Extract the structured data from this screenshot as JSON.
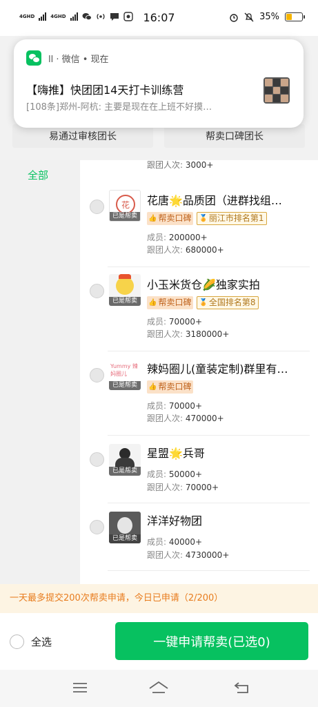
{
  "status_bar": {
    "time": "16:07",
    "battery_text": "35%",
    "battery_level": 0.35,
    "signal_labels": [
      "4GHD",
      "4GHD"
    ],
    "icons": [
      "signal-icon",
      "wechat-status-icon",
      "hotspot-icon",
      "message-icon",
      "app-icon",
      "alarm-icon",
      "mute-icon",
      "battery-icon"
    ]
  },
  "notification": {
    "app_line": "ll · 微信 • 现在",
    "title": "【嗨推】快团团14天打卡训练营",
    "body": "[108条]郑州-阿杭: 主要是现在在上班不好摸…"
  },
  "filters": {
    "left": "易通过审核团长",
    "right": "帮卖口碑团长"
  },
  "sidebar": {
    "category_all": "全部"
  },
  "partial_item": {
    "followers_label": "跟团人次:",
    "followers_value": "3000+"
  },
  "labels": {
    "members": "成员:",
    "followers": "跟团人次:",
    "badge": "已是帮卖",
    "help_tag": "帮卖口碑"
  },
  "items": [
    {
      "name": "花唐🌟品质团（进群找组…",
      "members": "200000+",
      "followers": "680000+",
      "rank": "丽江市排名第1",
      "has_help_tag": true
    },
    {
      "name": "小玉米货仓🌽独家实拍",
      "members": "70000+",
      "followers": "3180000+",
      "rank": "全国排名第8",
      "has_help_tag": true
    },
    {
      "name": "辣妈圈儿(童装定制)群里有…",
      "members": "70000+",
      "followers": "470000+",
      "rank": "",
      "has_help_tag": true,
      "avatar_text": "Yummy 辣妈圈儿"
    },
    {
      "name": "星盟🌟兵哥",
      "members": "50000+",
      "followers": "70000+",
      "rank": "",
      "has_help_tag": false
    },
    {
      "name": "洋洋好物团",
      "members": "40000+",
      "followers": "4730000+",
      "rank": "",
      "has_help_tag": false
    }
  ],
  "notice": "一天最多提交200次帮卖申请，今日已申请（2/200）",
  "bottom": {
    "select_all": "全选",
    "apply_button": "一键申请帮卖(已选0)"
  }
}
